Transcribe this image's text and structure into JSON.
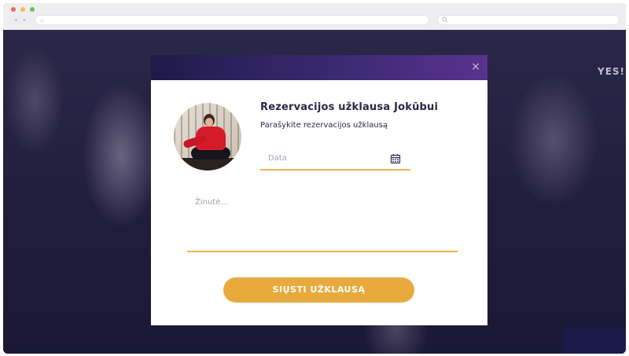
{
  "browser": {
    "nav_icon": "back-forward-arrows",
    "address_value": "",
    "search_value": ""
  },
  "background": {
    "shirt_text": "YES!!"
  },
  "modal": {
    "close_icon": "close-icon",
    "title": "Rezervacijos užklausa Jokūbui",
    "subtitle": "Parašykite rezervacijos užklausą",
    "date_placeholder": "Data",
    "date_icon": "calendar-icon",
    "message_placeholder": "Žinutė...",
    "submit_label": "SIŲSTI UŽKLAUSĄ"
  },
  "colors": {
    "accent": "#eab54a",
    "button": "#e8aa3d",
    "title_text": "#2b2747",
    "header_gradient_start": "#1f1a4a",
    "header_gradient_end": "#5a3290"
  }
}
